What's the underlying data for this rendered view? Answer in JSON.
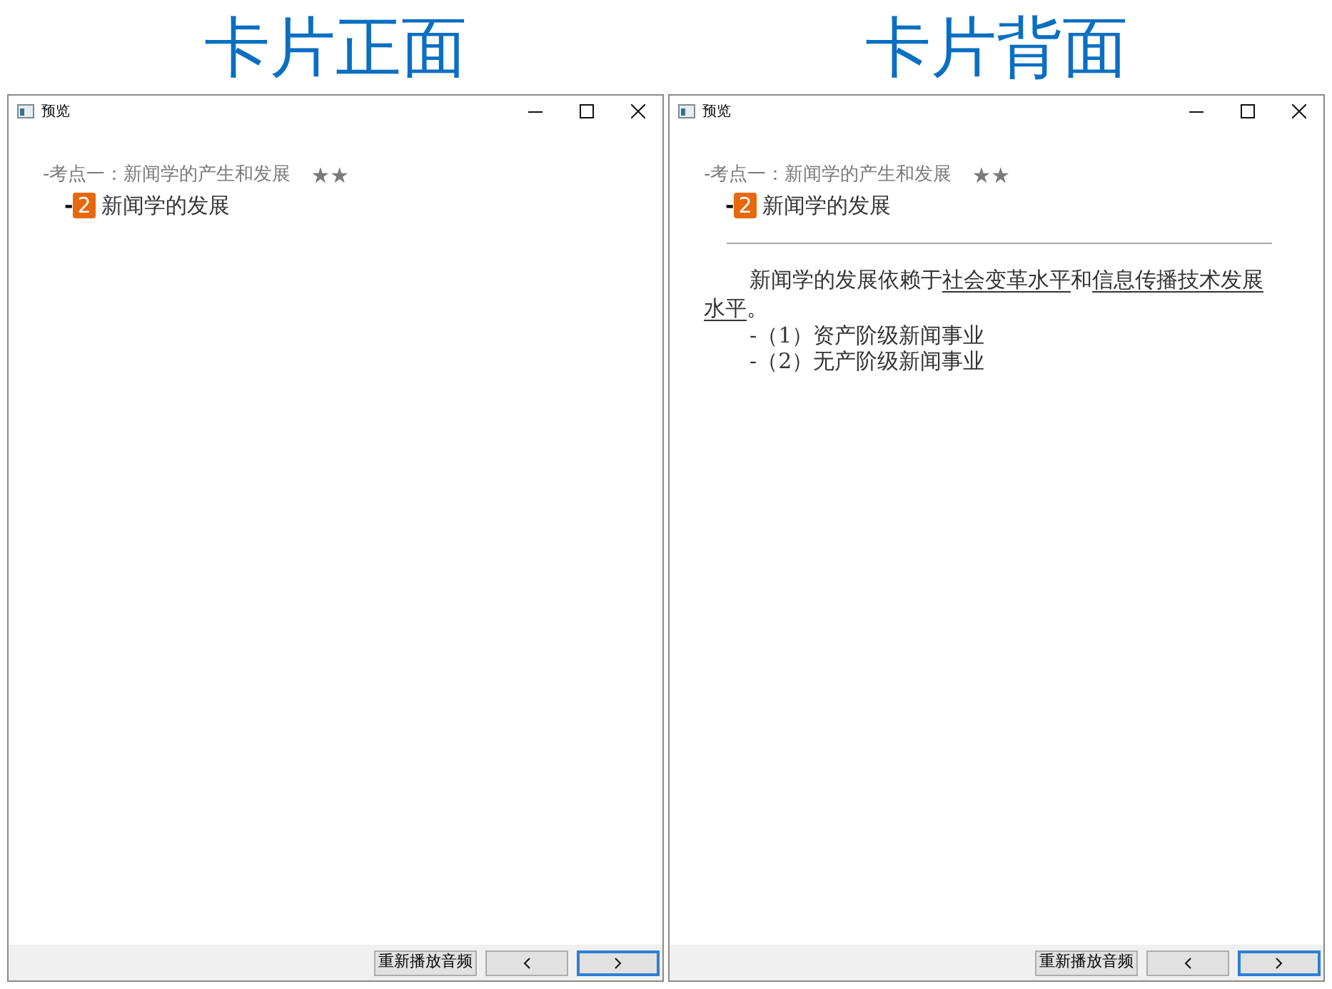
{
  "panels": [
    {
      "heading": "卡片正面",
      "window": {
        "title": "预览",
        "topic": {
          "text": "-考点一：新闻学的产生和发展",
          "rating": "★★"
        },
        "item": {
          "dash": "-",
          "number": "2",
          "title": "新闻学的发展"
        },
        "buttons": [
          {
            "kind": "text",
            "label": "重新播放音频",
            "focused": false
          },
          {
            "kind": "prev",
            "focused": false
          },
          {
            "kind": "next",
            "focused": true
          }
        ]
      }
    },
    {
      "heading": "卡片背面",
      "window": {
        "title": "预览",
        "topic": {
          "text": "-考点一：新闻学的产生和发展",
          "rating": "★★"
        },
        "item": {
          "dash": "-",
          "number": "2",
          "title": "新闻学的发展"
        },
        "divider": true,
        "paragraph": [
          {
            "text": "新闻学的发展依赖于",
            "underlined": false
          },
          {
            "text": "社会变革水平",
            "underlined": true
          },
          {
            "text": "和",
            "underlined": false
          },
          {
            "text": "信息传播技术发展水平",
            "underlined": true
          },
          {
            "text": "。",
            "underlined": false
          }
        ],
        "list": [
          "-（1）资产阶级新闻事业",
          "-（2）无产阶级新闻事业"
        ],
        "buttons": [
          {
            "kind": "text",
            "label": "重新播放音频",
            "focused": false
          },
          {
            "kind": "prev",
            "focused": false
          },
          {
            "kind": "next",
            "focused": true
          }
        ]
      }
    }
  ]
}
